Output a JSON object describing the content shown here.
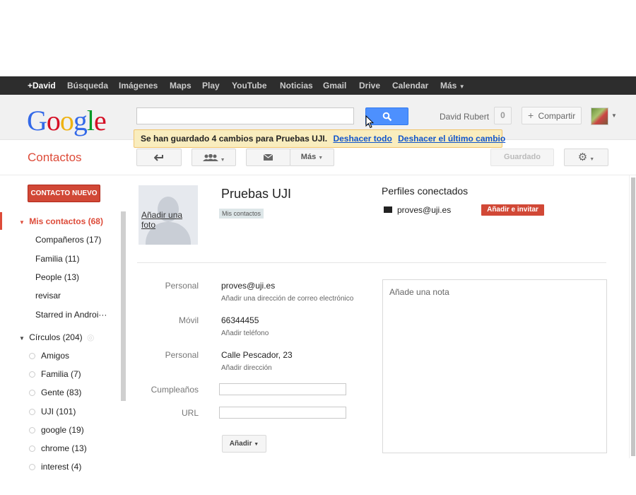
{
  "topbar": {
    "items": [
      "+David",
      "Búsqueda",
      "Imágenes",
      "Maps",
      "Play",
      "YouTube",
      "Noticias",
      "Gmail",
      "Drive",
      "Calendar",
      "Más"
    ]
  },
  "header": {
    "logo": [
      "G",
      "o",
      "o",
      "g",
      "l",
      "e"
    ],
    "user_name": "David Rubert",
    "notif_count": "0",
    "share_label": "Compartir"
  },
  "notice": {
    "message": "Se han guardado 4 cambios para Pruebas UJI.",
    "undo_all": "Deshacer todo",
    "undo_last": "Deshacer el último cambio"
  },
  "app": {
    "title": "Contactos",
    "more_label": "Más",
    "saved_label": "Guardado"
  },
  "sidebar": {
    "new_contact": "CONTACTO NUEVO",
    "my_contacts": "Mis contactos (68)",
    "groups": [
      "Compañeros (17)",
      "Familia (11)",
      "People (13)",
      "revisar",
      "Starred in Androi···"
    ],
    "circles_header": "Círculos (204)",
    "circles": [
      "Amigos",
      "Familia (7)",
      "Gente (83)",
      "UJI (101)",
      "google (19)",
      "chrome (13)",
      "interest (4)"
    ]
  },
  "contact": {
    "add_photo": "Añadir una foto",
    "name": "Pruebas UJI",
    "tag": "Mis contactos",
    "profiles_title": "Perfiles conectados",
    "profile_email": "proves@uji.es",
    "invite_label": "Añadir e invitar",
    "fields": {
      "email_label": "Personal",
      "email_value": "proves@uji.es",
      "email_hint": "Añadir una dirección de correo electrónico",
      "phone_label": "Móvil",
      "phone_value": "66344455",
      "phone_hint": "Añadir teléfono",
      "address_label": "Personal",
      "address_value": "Calle Pescador, 23",
      "address_hint": "Añadir dirección",
      "birthday_label": "Cumpleaños",
      "url_label": "URL"
    },
    "note_placeholder": "Añade una nota",
    "add_button": "Añadir"
  },
  "colors": {
    "accent_red": "#dd4b39",
    "button_red": "#d14836",
    "search_blue": "#4d90fe",
    "link_blue": "#1155cc",
    "notice_bg": "#f9edbe"
  }
}
